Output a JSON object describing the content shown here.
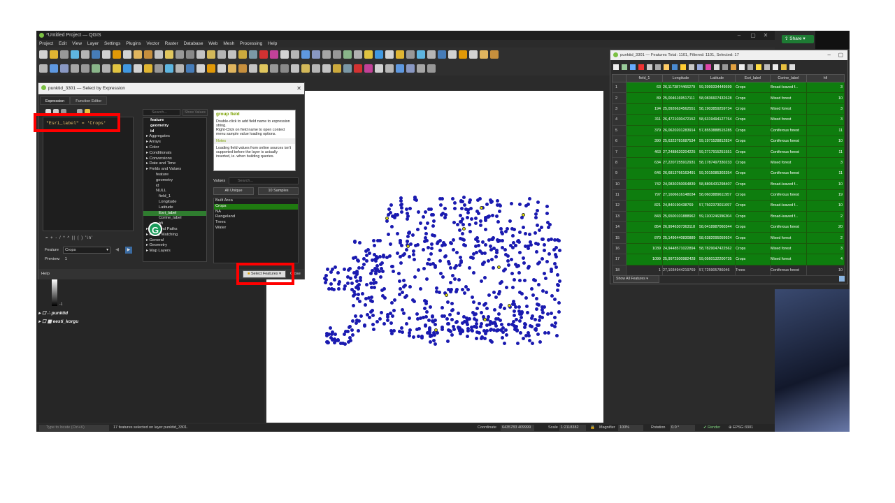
{
  "window": {
    "title": "*Untitled Project — QGIS"
  },
  "menu": [
    "Project",
    "Edit",
    "View",
    "Layer",
    "Settings",
    "Plugins",
    "Vector",
    "Raster",
    "Database",
    "Web",
    "Mesh",
    "Processing",
    "Help"
  ],
  "share": {
    "label": "Share"
  },
  "dialog": {
    "title": "punktid_3301 — Select by Expression",
    "tabs": [
      "Expression",
      "Function Editor"
    ],
    "expression": "\"Esri_label\" = 'Crops'",
    "search_placeholder": "Search...",
    "show_values": "Show Values",
    "tree": [
      {
        "label": "feature",
        "bold": true
      },
      {
        "label": "geometry",
        "bold": true
      },
      {
        "label": "id",
        "bold": true
      },
      {
        "label": "Aggregates",
        "group": true
      },
      {
        "label": "Arrays",
        "group": true
      },
      {
        "label": "Color",
        "group": true
      },
      {
        "label": "Conditionals",
        "group": true
      },
      {
        "label": "Conversions",
        "group": true
      },
      {
        "label": "Date and Time",
        "group": true
      },
      {
        "label": "Fields and Values",
        "group": true
      },
      {
        "label": "feature"
      },
      {
        "label": "geometry"
      },
      {
        "label": "id"
      },
      {
        "label": "NULL"
      },
      {
        "label": "field_1"
      },
      {
        "label": "Longitude"
      },
      {
        "label": "Latitude"
      },
      {
        "label": "Esri_label",
        "selected": true
      },
      {
        "label": "Corine_label"
      },
      {
        "label": "hfi"
      },
      {
        "label": "Files and Paths",
        "group": true
      },
      {
        "label": "Fuzzy Matching",
        "group": true
      },
      {
        "label": "General",
        "group": true
      },
      {
        "label": "Geometry",
        "group": true
      },
      {
        "label": "Map Layers",
        "group": true
      }
    ],
    "help": {
      "heading": "group field",
      "p1": "Double-click to add field name to expression string.",
      "p2": "Right-Click on field name to open context menu sample value loading options.",
      "notes_label": "Notes",
      "p3": "Loading field values from online sources isn't supported before the layer is actually inserted, ie. when building queries."
    },
    "values_label": "Values",
    "values_search_placeholder": "Search...",
    "all_unique": "All Unique",
    "ten_samples": "10 Samples",
    "values": [
      {
        "label": "Built Area"
      },
      {
        "label": "Crops",
        "selected": true
      },
      {
        "label": "NA"
      },
      {
        "label": "Rangeland"
      },
      {
        "label": "Trees"
      },
      {
        "label": "Water"
      }
    ],
    "operators": "= + - / * ^ || ( ) '\\n'",
    "feature_label": "Feature",
    "feature_value": "Crops",
    "preview_label": "Preview:",
    "preview_value": "1",
    "help_button": "Help",
    "select_features_button": "Select Features",
    "close_button": "Close"
  },
  "layers": [
    {
      "name": "punktid"
    },
    {
      "name": "eesti_korgu"
    }
  ],
  "legend_min": "-1",
  "status": {
    "locator_placeholder": "Type to locate (Ctrl+K)",
    "message": "17 features selected on layer punktid_3301.",
    "coordinate_label": "Coordinate",
    "coordinate": "6435783 409999",
    "scale_label": "Scale",
    "scale": "1:2118382",
    "magnifier_label": "Magnifier",
    "magnifier": "100%",
    "rotation_label": "Rotation",
    "rotation": "0.0 °",
    "render": "Render",
    "crs": "EPSG:3301"
  },
  "attr": {
    "title": "punktid_3301 — Features Total: 1101, Filtered: 1101, Selected: 17",
    "columns": [
      "field_1",
      "Longitude",
      "Latitude",
      "Esri_label",
      "Corine_label",
      "hfi"
    ],
    "rows": [
      [
        "1",
        "63",
        "26,1173874466279",
        "59,3999334449599",
        "Crops",
        "Broad-leaved f...",
        "3"
      ],
      [
        "2",
        "89",
        "25,0046169517111",
        "58,0836607432628",
        "Crops",
        "Mixed forest",
        "10"
      ],
      [
        "3",
        "194",
        "25,0926624562551",
        "58,1903859259734",
        "Crops",
        "Mixed forest",
        "3"
      ],
      [
        "4",
        "311",
        "26,4721030472152",
        "58,6319494127764",
        "Crops",
        "Mixed forest",
        "3"
      ],
      [
        "5",
        "379",
        "26,0620201283914",
        "57,8553888515285",
        "Crops",
        "Coniferous forest",
        "11"
      ],
      [
        "6",
        "390",
        "25,6323781687534",
        "59,1971528812824",
        "Crops",
        "Coniferous forest",
        "10"
      ],
      [
        "7",
        "463",
        "27,2488620204225",
        "59,2717915251551",
        "Crops",
        "Coniferous forest",
        "11"
      ],
      [
        "8",
        "634",
        "27,2207255912931",
        "58,1787497330233",
        "Crops",
        "Mixed forest",
        "3"
      ],
      [
        "9",
        "646",
        "26,6813766163491",
        "59,2015085303354",
        "Crops",
        "Coniferous forest",
        "11"
      ],
      [
        "10",
        "742",
        "24,0830250064839",
        "58,8806431298407",
        "Crops",
        "Broad-leaved f...",
        "10"
      ],
      [
        "11",
        "797",
        "27,1606616148034",
        "58,0603889611957",
        "Crops",
        "Coniferous forest",
        "19"
      ],
      [
        "12",
        "821",
        "24,8401904387​69",
        "57,7502373011097",
        "Crops",
        "Broad-leaved f...",
        "10"
      ],
      [
        "13",
        "843",
        "25,6500101888962",
        "59,1100246396304",
        "Crops",
        "Broad-leaved f...",
        "2"
      ],
      [
        "14",
        "854",
        "26,9946307363118",
        "58,0418987060344",
        "Crops",
        "Coniferous forest",
        "20"
      ],
      [
        "15",
        "870",
        "25,1496440830889",
        "58,6382095059924",
        "Crops",
        "Mixed forest",
        "2"
      ],
      [
        "16",
        "1039",
        "24,9448571022894",
        "58,7829047422562",
        "Crops",
        "Mixed forest",
        "3"
      ],
      [
        "17",
        "1099",
        "25,9972500982428",
        "59,0560132200735",
        "Crops",
        "Mixed forest",
        "4"
      ],
      [
        "18",
        "1",
        "27,1034944219769",
        "57,7259057860​46",
        "Trees",
        "Coniferous forest",
        "10"
      ]
    ],
    "show_all": "Show All Features"
  },
  "colors": {
    "selected_row": "#0e7d0e",
    "point": "#1a1ab0",
    "selected_point": "#e6e600",
    "highlight_box": "#ff0000"
  }
}
